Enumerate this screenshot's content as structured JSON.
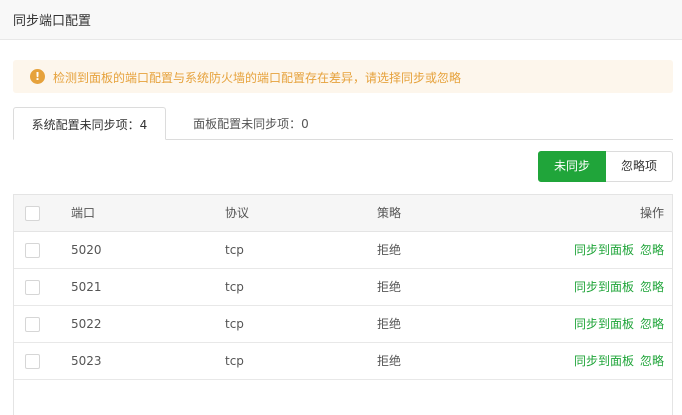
{
  "window": {
    "title": "同步端口配置"
  },
  "alert": {
    "icon": "warning-icon",
    "color": "#e6a23c",
    "text": "检测到面板的端口配置与系统防火墙的端口配置存在差异，请选择同步或忽略"
  },
  "tabs": [
    {
      "label": "系统配置未同步项：4",
      "active": true
    },
    {
      "label": "面板配置未同步项：0",
      "active": false
    }
  ],
  "filter": {
    "unsynced_label": "未同步",
    "ignored_label": "忽略项",
    "accent": "#20a53a"
  },
  "table": {
    "columns": {
      "port": "端口",
      "protocol": "协议",
      "policy": "策略",
      "actions": "操作"
    },
    "rows": [
      {
        "port": "5020",
        "protocol": "tcp",
        "policy": "拒绝",
        "sync": "同步到面板",
        "ignore": "忽略"
      },
      {
        "port": "5021",
        "protocol": "tcp",
        "policy": "拒绝",
        "sync": "同步到面板",
        "ignore": "忽略"
      },
      {
        "port": "5022",
        "protocol": "tcp",
        "policy": "拒绝",
        "sync": "同步到面板",
        "ignore": "忽略"
      },
      {
        "port": "5023",
        "protocol": "tcp",
        "policy": "拒绝",
        "sync": "同步到面板",
        "ignore": "忽略"
      }
    ]
  }
}
